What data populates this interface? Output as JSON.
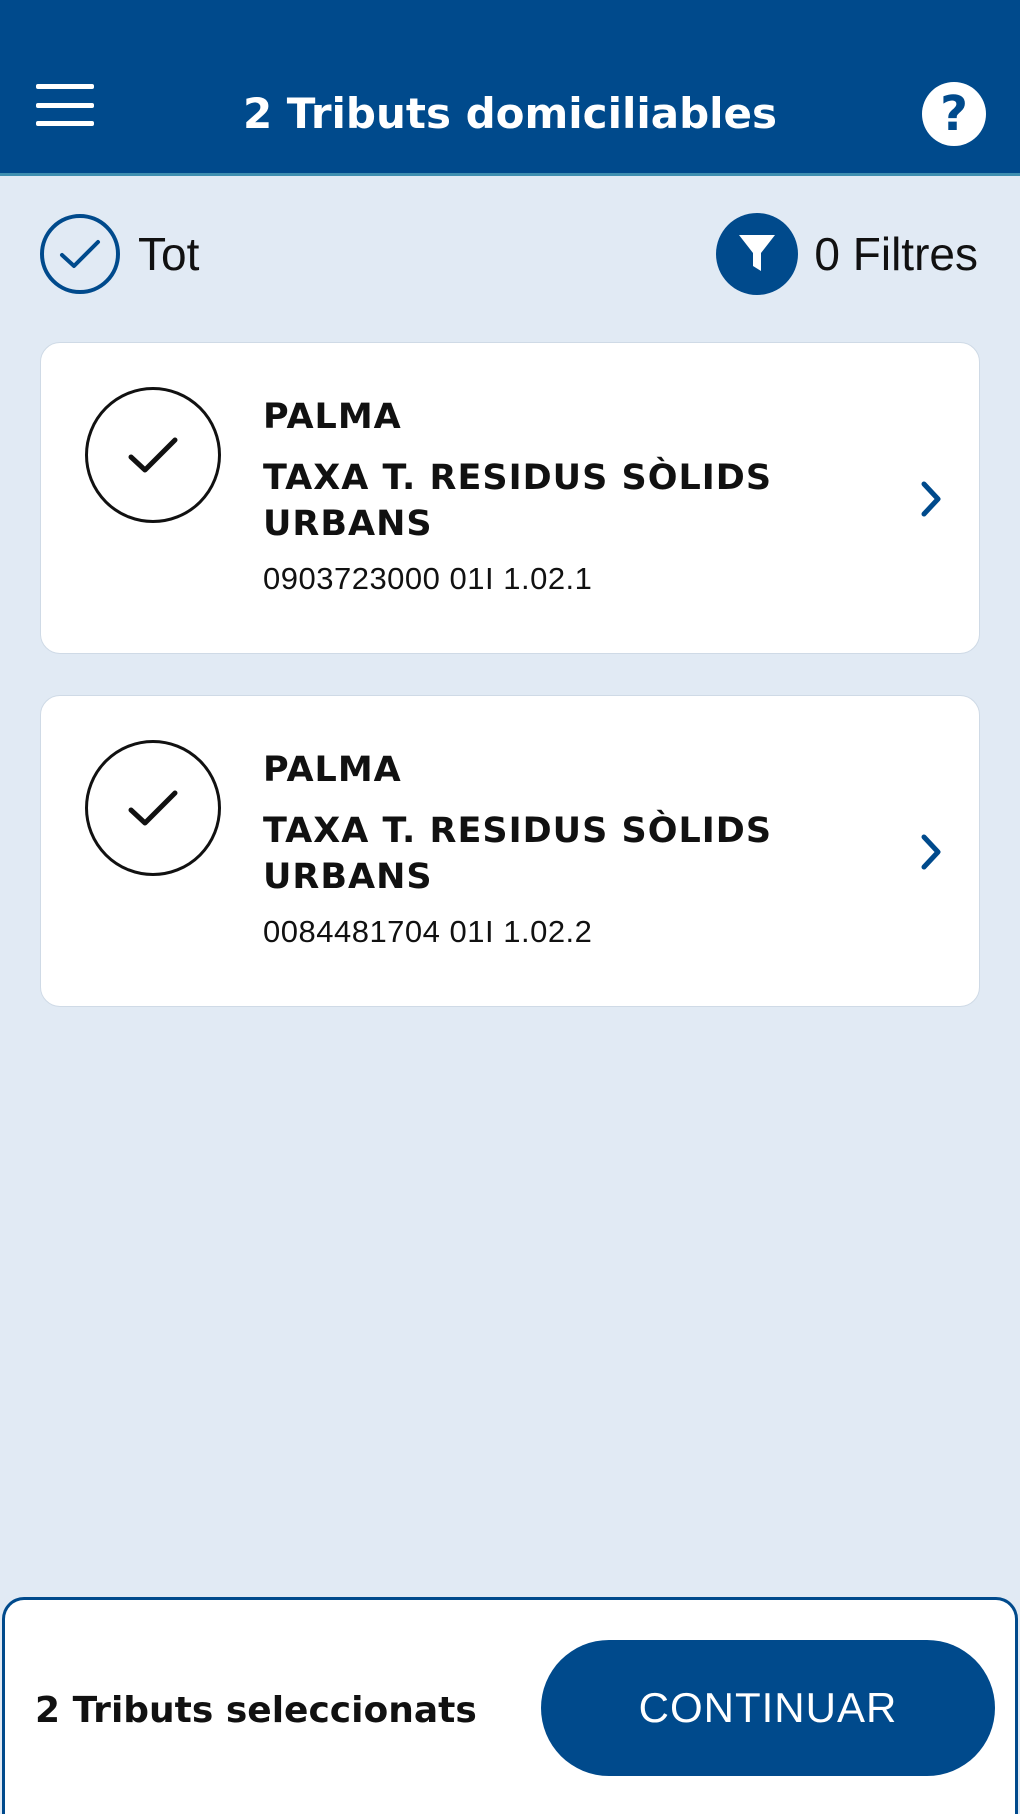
{
  "header": {
    "title": "2 Tributs domiciliables",
    "menu_icon": "hamburger-menu-icon",
    "help_label": "?"
  },
  "toolbar": {
    "select_all_label": "Tot",
    "select_all_icon": "check-circle-icon",
    "filters_label": "0 Filtres",
    "filters_icon": "filter-funnel-icon"
  },
  "items": [
    {
      "city": "PALMA",
      "tax": "TAXA T. RESIDUS SÒLIDS URBANS",
      "reference": "0903723000 01I 1.02.1",
      "selected": true
    },
    {
      "city": "PALMA",
      "tax": "TAXA T. RESIDUS SÒLIDS URBANS",
      "reference": "0084481704 01I 1.02.2",
      "selected": true
    }
  ],
  "footer": {
    "selected_count": "2 Tributs seleccionats",
    "continue_label": "CONTINUAR"
  },
  "colors": {
    "primary": "#004a8c",
    "background": "#e1eaf4",
    "card": "#ffffff"
  }
}
